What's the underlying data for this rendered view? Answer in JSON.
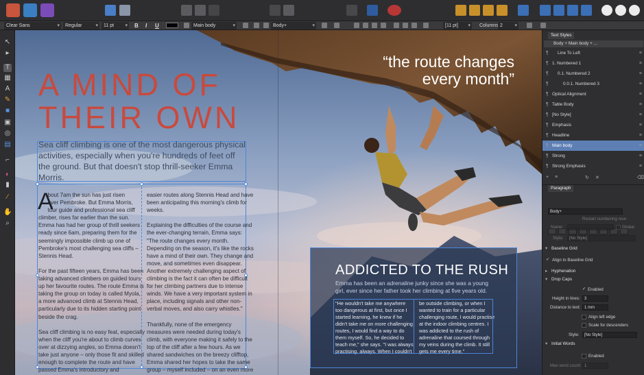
{
  "toolbar": {
    "personas": [
      {
        "name": "publisher-persona-icon",
        "color": "#c8553d"
      },
      {
        "name": "designer-persona-icon",
        "color": "#3a7fc1"
      },
      {
        "name": "photo-persona-icon",
        "color": "#7b4cb8"
      }
    ]
  },
  "context_bar": {
    "font_family": "Clear Sans",
    "font_style": "Regular",
    "font_size": "11 pt",
    "bold": "B",
    "italic": "I",
    "underline": "U",
    "paragraph_style": "Main body",
    "character_style": "Body+",
    "leading": "[11 pt]",
    "columns_label": "Columns:",
    "columns_value": "2"
  },
  "document": {
    "title_line1": "A MIND OF",
    "title_line2": "THEIR OWN",
    "subtitle": "Sea cliff climbing is one of the most dangerous physical activities, especially when you're hundreds of feet off the ground. But that doesn't stop thrill-seeker Emma Morris.",
    "drop_cap": "A",
    "col1": "      bout 7am the sun has just risen\n      over Pembroke. But Emma Morris,\n      tour guide and professional sea cliff\nclimber, rises far earlier than the sun.\nEmma has had her group of thrill seekers\nready since 6am, preparing them for the\nseemingly impossible climb up one of\nPembroke's most challenging sea cliffs –\nStennis Head.\n\nFor the past fifteen years, Emma has been\ntaking advanced climbers on guided tours\nup her favourite routes. The route Emma is\ntaking the group on today is called Myola,\na more advanced climb at Stennis Head,\nparticularly due to its hidden starting point\nbeside the crag.\n\nSea cliff climbing is no easy feat, especially\nwhen the cliff you're about to climb curves\nover at dizzying angles, so Emma doesn't\ntake just anyone – only those fit and skilled\nenough to complete the route and have\npassed Emma's introductory and\nintermediate courses. Most of the climbers\non the tour today have completed the",
    "col2": "easier routes along Stennis Head and have\nbeen anticipating this morning's climb for\nweeks.\n\nExplaining the difficulties of the course and\nthe ever-changing terrain, Emma says:\n\"The route changes every month.\nDepending on the season, it's like the rocks\nhave a mind of their own. They change and\nmove, and sometimes even disappear.\nAnother extremely challenging aspect of\nclimbing is the fact it can often be difficult\nfor her climbing partners due to intense\nwinds. We have a very important system in\nplace, including signals and other non-\nverbal moves, and also carry whistles.\"\n\nThankfully, none of the emergency\nmeasures were needed during today's\nclimb, with everyone making it safely to the\ntop of the cliff after a few hours. As we\nshared sandwiches on the breezy clifftop,\nEmma shared her hopes to take the same\ngroup – myself included – on an even more\ndifficult route in a few weeks. I better get\npractising!",
    "pull_quote": "“the route changes\nevery month”",
    "panel_title": "ADDICTED TO THE RUSH",
    "panel_sub": "Emma has been an adrenaline junky since she was a young girl, ever since her father took her climbing at five years old.",
    "panel_col1": "\"He wouldn't take me anywhere\ntoo dangerous at first, but once I\nstarted learning, he knew if he\ndidn't take me on more challenging\nroutes, I would find a way to do\nthem myself. So, he decided to\nteach me,\" she says. \"I was always\npractising, always. When I couldn't",
    "panel_col2": "be outside climbing, or when I\nwanted to train for a particular\nchallenging route, I would practise\nat the indoor climbing centres. I\nwas addicted to the rush of\nadrenaline that coursed through\nmy veins during the climb. It still\ngets me every time.\""
  },
  "text_styles": {
    "tab_label": "Text Styles",
    "current": "Body + Main body + ...",
    "items": [
      {
        "name": "Line To Left",
        "indent": 1
      },
      {
        "name": "1.  Numbered 1",
        "indent": 0
      },
      {
        "name": "0.1.    Numbered 2",
        "indent": 1
      },
      {
        "name": "0.0.1.     Numbered 3",
        "indent": 2
      },
      {
        "name": "Optical Alignment",
        "indent": 0
      },
      {
        "name": "Table Body",
        "indent": 0
      },
      {
        "name": "[No Style]",
        "indent": 0
      },
      {
        "name": "Emphasis",
        "indent": 0
      },
      {
        "name": "Headline",
        "indent": 0
      },
      {
        "name": "Main body",
        "indent": 0,
        "selected": true
      },
      {
        "name": "Strong",
        "indent": 0
      },
      {
        "name": "Strong Emphasis",
        "indent": 0
      }
    ]
  },
  "paragraph": {
    "tab_label": "Paragraph",
    "style_value": "Body+",
    "restart_label": "Restart numbering now",
    "name_label": "Name:",
    "global_label": "Global",
    "style_label": "Style:",
    "style_placeholder": "[No Style]",
    "baseline_grid": "Baseline Grid",
    "align_baseline": "Align to Baseline Grid",
    "hyphenation": "Hyphenation",
    "drop_caps": "Drop Caps",
    "enabled": "Enabled",
    "height_label": "Height in lines:",
    "height_value": "3",
    "distance_label": "Distance to text:",
    "distance_value": "1 mm",
    "align_left_edge": "Align left edge",
    "scale_descenders": "Scale for descenders",
    "dc_style_label": "Style:",
    "dc_style_value": "[No Style]",
    "initial_words": "Initial Words",
    "iw_enabled": "Enabled",
    "max_word_label": "Max word count:",
    "max_word_value": "1"
  },
  "colors": {
    "accent": "#4c86d9",
    "title_red": "#c84a3e",
    "selection": "#5d7fb4"
  }
}
